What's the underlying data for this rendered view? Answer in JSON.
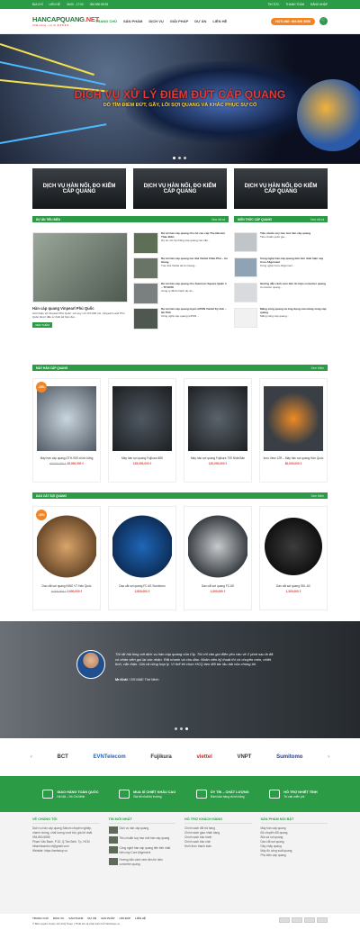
{
  "topbar": {
    "left": [
      "ĐỊA CHỈ",
      "LIÊN HỆ",
      "08:00 - 17:00",
      "094 890 55 55"
    ],
    "right": [
      "TIN TỨC",
      "THANH TOÁN",
      "ĐĂNG NHẬP"
    ]
  },
  "header": {
    "logo_main": "HANCAPQUANG",
    "logo_tld": ".NET",
    "logo_sub": "Chất lượng – Uy tín ★★★★★",
    "nav": [
      "TRANG CHỦ",
      "SẢN PHẨM",
      "DỊCH VỤ",
      "GIẢI PHÁP",
      "DỰ ÁN",
      "LIÊN HỆ"
    ],
    "hotline": "HOTLINE: 094 890 5555",
    "cart_icon": "cart-icon"
  },
  "hero": {
    "title": "DỊCH VỤ XỬ LÝ ĐIỂM ĐỨT CÁP QUANG",
    "subtitle": "DÒ TÌM ĐIỂM ĐỨT, GÃY, LỖI SỢI QUANG VÀ KHẮC PHỤC SỰ CỐ"
  },
  "banners": [
    "DỊCH VỤ HÀN NỐI, ĐO KIỂM CÁP QUANG",
    "DỊCH VỤ HÀN NỐI, ĐO KIỂM CÁP QUANG",
    "DỊCH VỤ HÀN NỐI, ĐO KIỂM CÁP QUANG"
  ],
  "projects": {
    "bar": "DỰ ÁN TIÊU BIỂU",
    "more": "Xem tất cả",
    "main_title": "Hàn cáp quang Vinpearl Phú Quốc",
    "main_desc": "Giới thiệu về Vinpearl Phú Quốc: với quy mô 170.000 m2, Vinpearl Land Phú Quốc được đầu tư thiết kế hiện đại...",
    "btn": "XEM THÊM",
    "list": [
      {
        "t": "Dự án hàn cáp quang cho hộ cao cấp The Nassim Thảo Điền",
        "d": "Dự án với hệ thống cáp quang cao cấp..."
      },
      {
        "t": "Dự án hàn cáp quang tòa nhà Viettel Châu Phú – An Giang",
        "d": "Tòa nhà Viettel tại An Giang..."
      },
      {
        "t": "Dự án hàn cáp quang cho Summon Square Quận 4 – TP.HCM",
        "d": "Công ty đã thi hành dự án..."
      },
      {
        "t": "Dự án hàn cáp quang tuyến GPON Viettel Kỳ Anh – Hà Tĩnh",
        "d": "Công nghệ cáp quang GPON..."
      }
    ]
  },
  "knowledge": {
    "bar": "KIẾN THỨC CÁP QUANG",
    "more": "Xem tất cả",
    "list": [
      {
        "t": "Tiêu chuẩn suy hao mối hàn cáp quang",
        "d": "Tiêu chuẩn quốc gia..."
      },
      {
        "t": "Công nghệ hàn cáp quang tiên tiến nhất hiện nay Core Alignment",
        "d": "Công nghệ Core Alignment..."
      },
      {
        "t": "Hướng dẫn cách xem đèn tín hiệu converter quang",
        "d": "Converter quang..."
      },
      {
        "t": "Măng xông quang và ứng dụng của măng xông cáp quang",
        "d": "Măng xông cáp quang..."
      }
    ]
  },
  "fusion": {
    "bar": "MÁY HÀN CÁP QUANG",
    "more": "Xem thêm",
    "items": [
      {
        "badge": "-25%",
        "name": "Máy hàn cáp quang DTH-90S chính hãng",
        "old": "60,000,000 ₫",
        "price": "45,000,000 ₫"
      },
      {
        "badge": "",
        "name": "Máy hàn sợi quang Fujikura 88S",
        "old": "",
        "price": "125,000,000 ₫"
      },
      {
        "badge": "",
        "name": "Máy hàn sợi quang Fujikura 70S Nhật Bản",
        "old": "",
        "price": "120,000,000 ₫"
      },
      {
        "badge": "",
        "name": "Inno View 12R – Máy hàn sợi quang Hàn Quốc",
        "old": "",
        "price": "80,000,000 ₫"
      }
    ]
  },
  "cleaver": {
    "bar": "DAO CẮT SỢI QUANG",
    "more": "Xem thêm",
    "items": [
      {
        "badge": "-40%",
        "name": "Dao cắt sợi quang INNO V7 Hàn Quốc",
        "old": "6,000,000 ₫",
        "price": "3,600,000 ₫"
      },
      {
        "badge": "",
        "name": "Dao cắt sợi quang FC-6S Sumitomo",
        "old": "",
        "price": "2,800,000 ₫"
      },
      {
        "badge": "",
        "name": "Dao cắt sợi quang FC-6S",
        "old": "",
        "price": "1,500,000 ₫"
      },
      {
        "badge": "",
        "name": "Dao cắt sợi quang SKL-6C",
        "old": "",
        "price": "1,300,000 ₫"
      }
    ]
  },
  "testimonial": {
    "quote": "Tôi rất hài lòng với dịch vụ hàn cáp quang của Cty. Tôi chỉ cần gọi điện yêu cầu về 2 phút sau là đã có nhân viên gọi lại xác nhận. Rất nhanh và chu đáo. Nhân viên kỹ thuật thì có chuyên môn, nhiệt tình, cẩn thận. Giá cả cũng hợp lý. Vì thế tôi chọn HCQ làm đối tác lâu dài của chúng tôi.",
    "name": "Mr.Khải",
    "role": "/ GS M&E Thế Minh"
  },
  "brands": [
    "BCT",
    "EVNTelecom",
    "Fujikura",
    "viettel",
    "VNPT",
    "Sumitomo"
  ],
  "features": [
    {
      "t": "GIAO HÀNG TOÀN QUỐC",
      "s": "Hà Nội – Hồ Chí Minh"
    },
    {
      "t": "MUA SỈ CHIẾT KHẤU CAO",
      "s": "Giá tốt nhất thị trường"
    },
    {
      "t": "ỦY TÍN – CHẤT LƯỢNG",
      "s": "Đảm bảo hàng chính hãng"
    },
    {
      "t": "HỖ TRỢ NHIỆT TÌNH",
      "s": "Tư vấn miễn phí"
    }
  ],
  "footer": {
    "about_h": "VỀ CHÚNG TÔI",
    "about": "Dịch vụ hàn cáp quang Sahcm chuyên nghiệp, nhanh chóng, chất lượng vượt trội, giá tốt nhất.",
    "phone": "094.890.5555",
    "addr": "Phạm Văn Bạch, P.15, Q.Tân Bình, Tp. HCM",
    "email": "hthanhtoanbn.vt@gmail.com",
    "web": "Website: https://webstop.vn",
    "news_h": "TIN MỚI NHẤT",
    "news": [
      "Dịch vụ hàn cáp quang",
      "Tiêu chuẩn suy hao mối hàn cáp quang",
      "Công nghệ hàn cáp quang tiên tiến nhất hiện nay Core Alignment",
      "Hướng dẫn cách xem đèn tín hiệu converter quang"
    ],
    "support_h": "HỖ TRỢ KHÁCH HÀNG",
    "support": [
      "Chính sách đổi trả hàng",
      "Chính sách giao nhận hàng",
      "Chính sách bảo hành",
      "Chính sách bảo mật",
      "Hình thức thanh toán"
    ],
    "products_h": "SẢN PHẨM NỔI BẬT",
    "products": [
      "Máy hàn cáp quang",
      "Bộ chuyển đổi quang",
      "Bút soi sợi quang",
      "Dao cắt sợi quang",
      "Dây nhảy quang",
      "Máy đo công suất quang",
      "Phụ kiện cáp quang"
    ]
  },
  "bottom": {
    "links": [
      "TRANG CHỦ",
      "DỊCH VỤ",
      "SẢN PHẨM",
      "DỰ ÁN",
      "GIẢI PHÁP",
      "HỎI ĐÁP",
      "LIÊN HỆ"
    ],
    "copy": "© Bản quyền thuộc về HCQ Team | Thiết kế và phát triển bởi Webstop.vn"
  },
  "colors": {
    "brand": "#2c9b46",
    "accent": "#f5841f",
    "price": "#e53935"
  }
}
